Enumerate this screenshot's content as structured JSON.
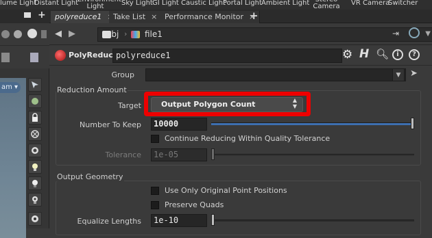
{
  "shelf": {
    "items": [
      "lume Light",
      "Distant Light",
      "Environment Light",
      "Sky Light",
      "GI Light",
      "Caustic Light",
      "Portal Light",
      "Ambient Light",
      "Stereo Camera",
      "VR Camera",
      "Switcher"
    ]
  },
  "left": {
    "pill_label": "am",
    "tools": [
      "select-tool-icon",
      "edit-tool-icon",
      "lock-icon",
      "snap-icon",
      "view-icon",
      "light-icon",
      "render-icon",
      "display-icon",
      "handle-icon"
    ]
  },
  "tabs": {
    "items": [
      {
        "label": "polyreduce1",
        "closable": true,
        "active": true
      },
      {
        "label": "Take List",
        "closable": true,
        "active": false
      },
      {
        "label": "Performance Monitor",
        "closable": true,
        "active": false
      }
    ],
    "add_label": "+"
  },
  "path": {
    "segment1": "obj",
    "segment2": "file1"
  },
  "node": {
    "type_label": "PolyReduce",
    "name_value": "polyreduce1"
  },
  "parms": {
    "group_label": "Group",
    "group_value": "",
    "reduction_section": "Reduction Amount",
    "target_label": "Target",
    "target_value": "Output Polygon Count",
    "number_label": "Number To Keep",
    "number_value": "10000",
    "number_fraction": 1.0,
    "continue_label": "Continue Reducing Within Quality Tolerance",
    "continue_checked": false,
    "tolerance_label": "Tolerance",
    "tolerance_value": "1e-05",
    "tolerance_fraction": 0.0,
    "output_section": "Output Geometry",
    "use_original_label": "Use Only Original Point Positions",
    "use_original_checked": false,
    "preserve_quads_label": "Preserve Quads",
    "preserve_quads_checked": false,
    "equalize_label": "Equalize Lengths",
    "equalize_value": "1e-10",
    "equalize_fraction": 0.0
  },
  "colors": {
    "highlight": "#ee0000",
    "slider_fill": "#3d6fb0"
  }
}
